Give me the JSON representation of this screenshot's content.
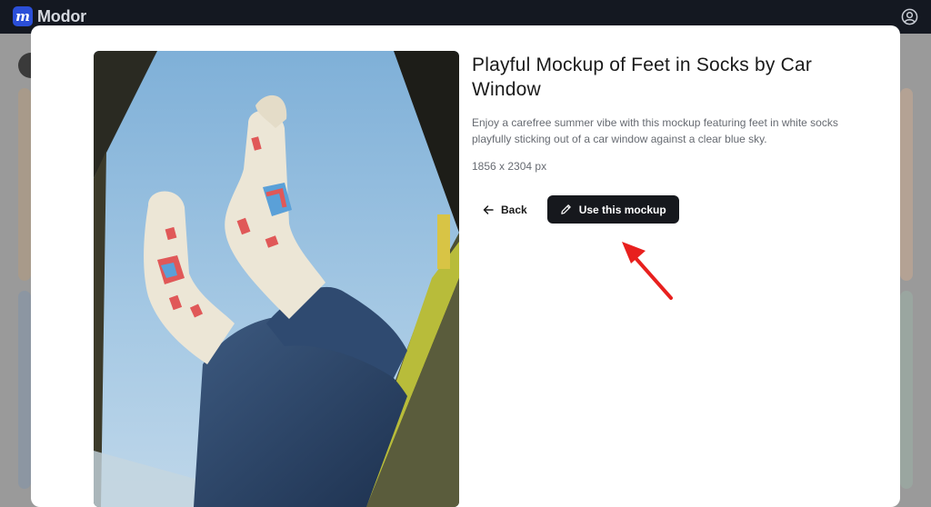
{
  "app": {
    "logo_letter": "m",
    "name": "Modor"
  },
  "modal": {
    "title": "Playful Mockup of Feet in Socks by Car Window",
    "description": "Enjoy a carefree summer vibe with this mockup featuring feet in white socks playfully sticking out of a car window against a clear blue sky.",
    "dimensions": "1856 x 2304 px",
    "back_label": "Back",
    "use_label": "Use this mockup",
    "image_alt": "Feet in patterned white socks sticking out of a car window against blue sky"
  },
  "colors": {
    "topbar": "#141821",
    "accent_logo": "#2b4fd8",
    "primary_button": "#16181d",
    "annotation_arrow": "#e8201e"
  },
  "icons": [
    "user-circle-icon",
    "arrow-left-icon",
    "pencil-icon",
    "red-pointer-arrow"
  ]
}
